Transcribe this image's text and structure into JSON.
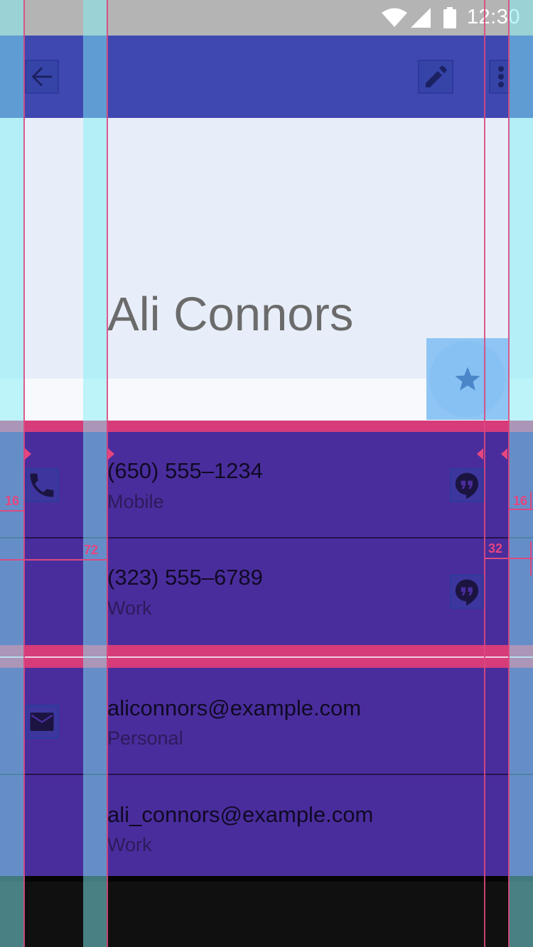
{
  "status_bar": {
    "time": "12:30"
  },
  "app_bar": {
    "back_icon": "arrow-back-icon",
    "edit_icon": "edit-pencil-icon",
    "more_icon": "more-vert-icon"
  },
  "contact": {
    "name": "Ali Connors"
  },
  "fab": {
    "icon": "star-icon"
  },
  "phones": [
    {
      "number": "(650) 555–1234",
      "type": "Mobile",
      "action_icon": "hangouts-icon"
    },
    {
      "number": "(323) 555–6789",
      "type": "Work",
      "action_icon": "hangouts-icon"
    }
  ],
  "emails": [
    {
      "address": "aliconnors@example.com",
      "type": "Personal"
    },
    {
      "address": "ali_connors@example.com",
      "type": "Work"
    }
  ],
  "keylines": {
    "left_margin": "16",
    "content_inset": "72",
    "right_margin": "16",
    "action_inset": "32"
  },
  "colors": {
    "app_bar": "#3f48b1",
    "hero": "#e8eef9",
    "list_overlay": "#4a2d9c",
    "keyline": "#d9487e",
    "margin_column": "#b3f6f8",
    "fab": "#8ec5f4"
  }
}
